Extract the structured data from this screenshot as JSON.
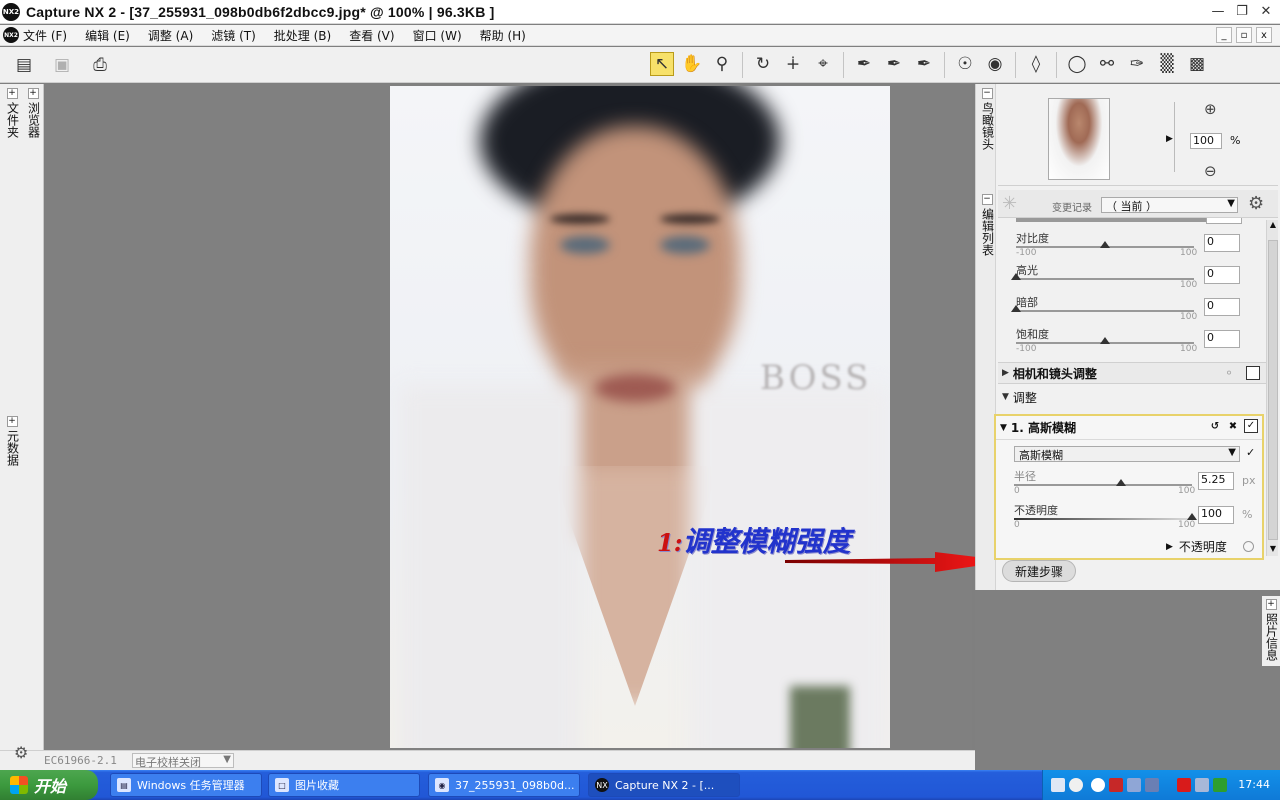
{
  "window": {
    "logo": "NX2",
    "title": "Capture  NX 2  -  [37_255931_098b0db6f2dbcc9.jpg* @ 100%  |  96.3KB ]",
    "controls": [
      "minimize-icon",
      "restore-icon",
      "close-icon"
    ]
  },
  "menu": {
    "items": [
      "文件 (F)",
      "编辑 (E)",
      "调整 (A)",
      "滤镜 (T)",
      "批处理 (B)",
      "查看 (V)",
      "窗口 (W)",
      "帮助 (H)"
    ],
    "mdi_controls": [
      "_",
      "▫",
      "x"
    ]
  },
  "toolbar": {
    "left_icons": [
      "browser-toggle-icon",
      "camera-icon",
      "print-icon"
    ],
    "right_icons": [
      "direct-select-icon",
      "hand-icon",
      "zoom-icon",
      "rotate-icon",
      "straighten-icon",
      "crop-icon",
      "black-point-icon",
      "neutral-point-icon",
      "white-point-icon",
      "red-eye-icon",
      "eye-icon",
      "tag-icon",
      "lasso-icon",
      "brush-icon",
      "gradient-icon",
      "fill-icon"
    ]
  },
  "left_dock": {
    "tabs": [
      "文件夹",
      "浏览器",
      "元数据"
    ]
  },
  "canvas": {
    "watermark": "BOSS",
    "annotation_num": "1:",
    "annotation_text": "调整模糊强度"
  },
  "statusbar": {
    "field": "EC61966-2.1",
    "combo": "电子校样关闭"
  },
  "birdseye": {
    "tab": "鸟瞰镜头",
    "zoom_value": "100",
    "zoom_unit": "%"
  },
  "edit_list": {
    "tab": "编辑列表",
    "history_label": "变更记录",
    "history_value": "（ 当前 ）",
    "sliders": [
      {
        "name": "对比度",
        "min": "-100",
        "max": "100",
        "value": "0",
        "level": 0.5
      },
      {
        "name": "高光",
        "min": "",
        "max": "100",
        "value": "0",
        "level": 0
      },
      {
        "name": "暗部",
        "min": "",
        "max": "100",
        "value": "0",
        "level": 0
      },
      {
        "name": "饱和度",
        "min": "-100",
        "max": "100",
        "value": "0",
        "level": 0.5
      }
    ],
    "camera_lens": "相机和镜头调整",
    "adjust": "调整",
    "gaussian": {
      "header": "1. 高斯模糊",
      "select": "高斯模糊",
      "radius": {
        "name": "半径",
        "min": "0",
        "max": "100",
        "value": "5.25",
        "unit": "px",
        "level": 0.6
      },
      "opacity": {
        "name": "不透明度",
        "min": "0",
        "max": "100",
        "value": "100",
        "unit": "%",
        "level": 1.0
      },
      "opacity_toggle": "不透明度"
    },
    "new_step": "新建步骤"
  },
  "right_dock2": {
    "tab": "照片信息"
  },
  "taskbar": {
    "start": "开始",
    "tasks": [
      "Windows 任务管理器",
      "图片收藏",
      "37_255931_098b0d...",
      "Capture NX 2 - [..."
    ],
    "clock": "17:44"
  }
}
